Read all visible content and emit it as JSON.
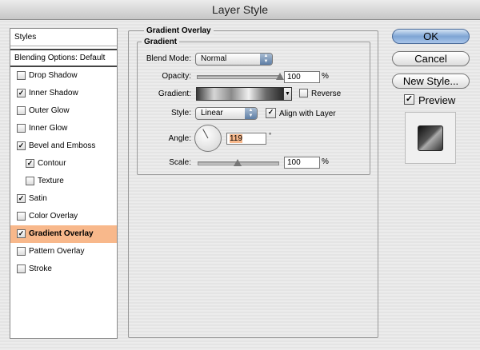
{
  "window": {
    "title": "Layer Style"
  },
  "styles_list": {
    "header": "Styles",
    "blending_options": "Blending Options: Default",
    "items": [
      {
        "label": "Drop Shadow",
        "checked": false,
        "indent": false,
        "selected": false
      },
      {
        "label": "Inner Shadow",
        "checked": true,
        "indent": false,
        "selected": false
      },
      {
        "label": "Outer Glow",
        "checked": false,
        "indent": false,
        "selected": false
      },
      {
        "label": "Inner Glow",
        "checked": false,
        "indent": false,
        "selected": false
      },
      {
        "label": "Bevel and Emboss",
        "checked": true,
        "indent": false,
        "selected": false
      },
      {
        "label": "Contour",
        "checked": true,
        "indent": true,
        "selected": false
      },
      {
        "label": "Texture",
        "checked": false,
        "indent": true,
        "selected": false
      },
      {
        "label": "Satin",
        "checked": true,
        "indent": false,
        "selected": false
      },
      {
        "label": "Color Overlay",
        "checked": false,
        "indent": false,
        "selected": false
      },
      {
        "label": "Gradient Overlay",
        "checked": true,
        "indent": false,
        "selected": true
      },
      {
        "label": "Pattern Overlay",
        "checked": false,
        "indent": false,
        "selected": false
      },
      {
        "label": "Stroke",
        "checked": false,
        "indent": false,
        "selected": false
      }
    ]
  },
  "gradient_overlay": {
    "section_title": "Gradient Overlay",
    "group_title": "Gradient",
    "blend_mode_label": "Blend Mode:",
    "blend_mode_value": "Normal",
    "opacity_label": "Opacity:",
    "opacity_value": "100",
    "opacity_unit": "%",
    "opacity_level": 1.0,
    "gradient_label": "Gradient:",
    "reverse_label": "Reverse",
    "reverse_checked": false,
    "style_label": "Style:",
    "style_value": "Linear",
    "align_label": "Align with Layer",
    "align_checked": true,
    "angle_label": "Angle:",
    "angle_value": "119",
    "angle_unit": "°",
    "angle_degrees": 119,
    "scale_label": "Scale:",
    "scale_value": "100",
    "scale_unit": "%",
    "scale_level": 0.5
  },
  "buttons": {
    "ok": "OK",
    "cancel": "Cancel",
    "new_style": "New Style..."
  },
  "preview": {
    "label": "Preview",
    "checked": true
  },
  "colors": {
    "selection": "#f8b88b",
    "default_button": "#7ea4d4"
  },
  "icons": {
    "checkbox_checked": "checkmark-icon",
    "popup_arrows": "up-down-arrows-icon"
  }
}
